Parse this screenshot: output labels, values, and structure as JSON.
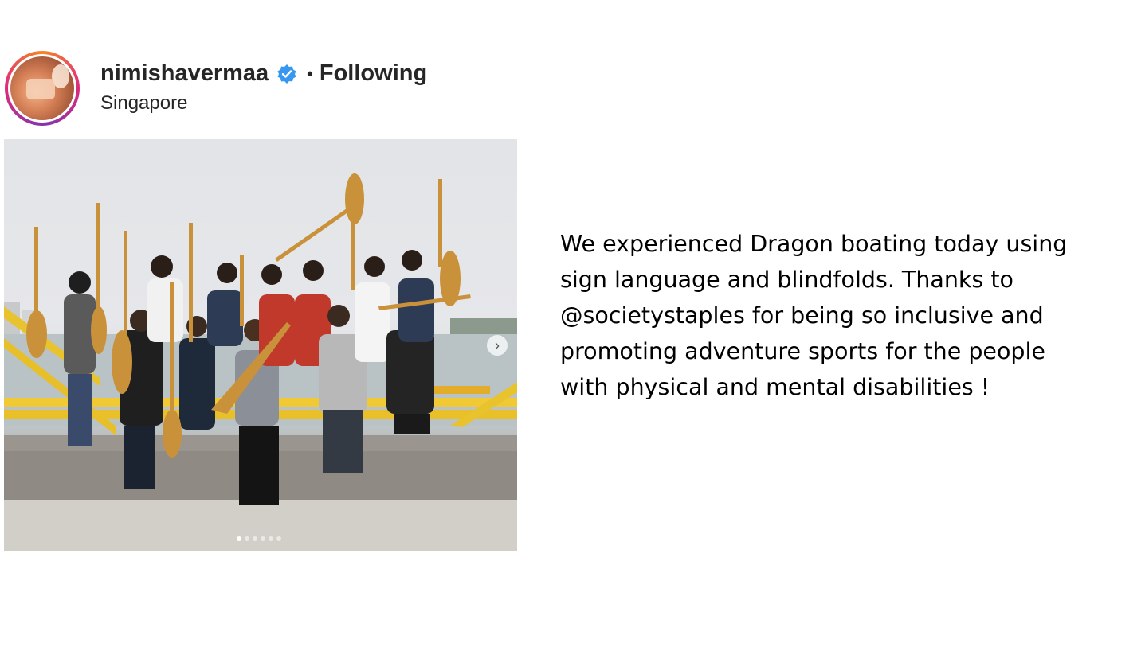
{
  "post": {
    "username": "nimishavermaa",
    "verified_icon": "verified-badge-icon",
    "separator": "•",
    "follow_state": "Following",
    "location": "Singapore",
    "avatar_icon": "profile-avatar",
    "colors": {
      "verified_badge": "#3897f0",
      "story_ring_start": "#f58529",
      "story_ring_end": "#8134af",
      "text": "#262626"
    }
  },
  "media": {
    "next_icon": "chevron-right-icon",
    "next_glyph": "›",
    "carousel_count": 6,
    "carousel_active_index": 0
  },
  "caption": {
    "lines": [
      "We experienced Dragon boating today using",
      "sign language and blindfolds. Thanks to",
      "@societystaples for being so inclusive and",
      "promoting adventure sports for the people",
      "with physical and mental disabilities !"
    ]
  }
}
